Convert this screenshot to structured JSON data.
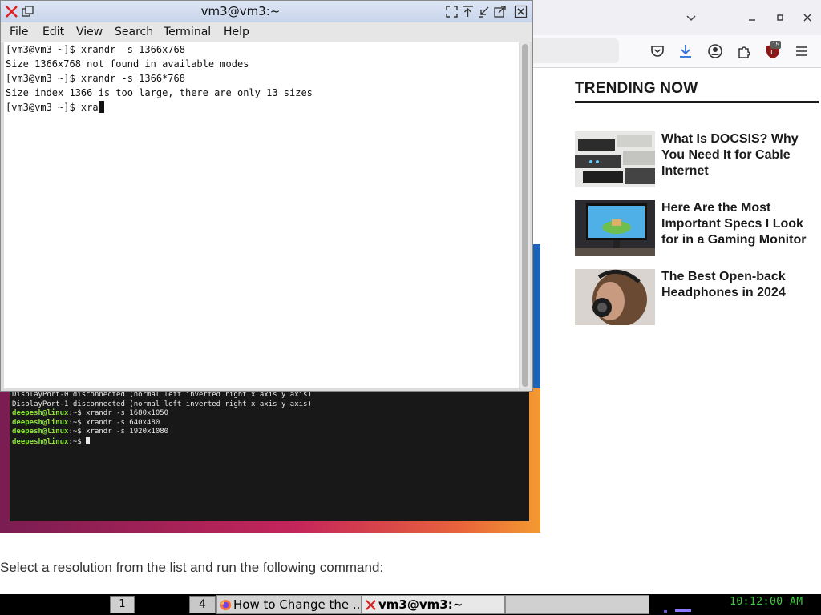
{
  "terminal": {
    "title": "vm3@vm3:~",
    "menu": [
      "File",
      "Edit",
      "View",
      "Search",
      "Terminal",
      "Help"
    ],
    "lines": [
      "[vm3@vm3 ~]$ xrandr -s 1366x768",
      "Size 1366x768 not found in available modes",
      "[vm3@vm3 ~]$ xrandr -s 1366*768",
      "Size index 1366 is too large, there are only 13 sizes",
      "[vm3@vm3 ~]$ xra"
    ]
  },
  "browser": {
    "extension_badge": "15",
    "trending": {
      "title": "TRENDING NOW",
      "items": [
        {
          "title": "What Is DOCSIS? Why You Need It for Cable Internet"
        },
        {
          "title": "Here Are the Most Important Specs I Look for in a Gaming Monitor"
        },
        {
          "title": "The Best Open-back Headphones in 2024"
        }
      ]
    },
    "embedded_terminal": {
      "lines": [
        {
          "text": "DisplayPort-0 disconnected (normal left inverted right x axis y axis)"
        },
        {
          "text": "DisplayPort-1 disconnected (normal left inverted right x axis y axis)"
        },
        {
          "prompt": "deepesh@linux",
          "text": ":~$ xrandr -s 1680x1050"
        },
        {
          "prompt": "deepesh@linux",
          "text": ":~$ xrandr -s 640x480"
        },
        {
          "prompt": "deepesh@linux",
          "text": ":~$ xrandr -s 1920x1080"
        },
        {
          "prompt": "deepesh@linux",
          "text": ":~$ "
        }
      ]
    },
    "article_caption": "Select a resolution from the list and run the following command:"
  },
  "taskbar": {
    "workspace_1": "1",
    "workspace_4": "4",
    "tasks": [
      {
        "label": "How to Change the ..."
      },
      {
        "label": "vm3@vm3:~"
      }
    ],
    "clock": "10:12:00 AM"
  }
}
